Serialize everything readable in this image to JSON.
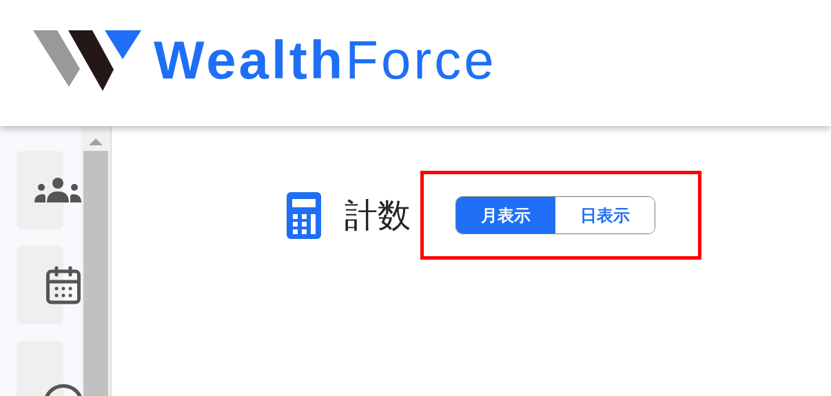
{
  "header": {
    "logo_text": "**Wealth**Force"
  },
  "sidebar": {
    "items": [
      {
        "kind": "people",
        "selected": false
      },
      {
        "kind": "calendar",
        "selected": false
      },
      {
        "kind": "check",
        "selected": false
      }
    ]
  },
  "main": {
    "title": "計数",
    "view_toggle": {
      "highlighted": true,
      "options": [
        {
          "label": "月表示",
          "selected": true
        },
        {
          "label": "日表示",
          "selected": false
        }
      ]
    }
  }
}
